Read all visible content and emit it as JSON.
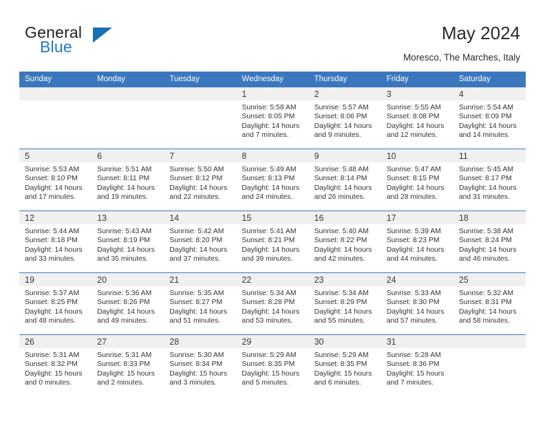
{
  "brand": {
    "name_part1": "General",
    "name_part2": "Blue",
    "triangle_color": "#1a6fb5",
    "blue_text_color": "#1f7ac4"
  },
  "header": {
    "title": "May 2024",
    "subtitle": "Moresco, The Marches, Italy"
  },
  "theme": {
    "header_blue": "#3b77bd",
    "daynum_band": "#f0f0f0",
    "text": "#333333"
  },
  "calendar": {
    "weekday_headers": [
      "Sunday",
      "Monday",
      "Tuesday",
      "Wednesday",
      "Thursday",
      "Friday",
      "Saturday"
    ],
    "weeks": [
      [
        {
          "day": "",
          "empty": true
        },
        {
          "day": "",
          "empty": true
        },
        {
          "day": "",
          "empty": true
        },
        {
          "day": "1",
          "sunrise": "Sunrise: 5:58 AM",
          "sunset": "Sunset: 8:05 PM",
          "daylight1": "Daylight: 14 hours",
          "daylight2": "and 7 minutes."
        },
        {
          "day": "2",
          "sunrise": "Sunrise: 5:57 AM",
          "sunset": "Sunset: 8:06 PM",
          "daylight1": "Daylight: 14 hours",
          "daylight2": "and 9 minutes."
        },
        {
          "day": "3",
          "sunrise": "Sunrise: 5:55 AM",
          "sunset": "Sunset: 8:08 PM",
          "daylight1": "Daylight: 14 hours",
          "daylight2": "and 12 minutes."
        },
        {
          "day": "4",
          "sunrise": "Sunrise: 5:54 AM",
          "sunset": "Sunset: 8:09 PM",
          "daylight1": "Daylight: 14 hours",
          "daylight2": "and 14 minutes."
        }
      ],
      [
        {
          "day": "5",
          "sunrise": "Sunrise: 5:53 AM",
          "sunset": "Sunset: 8:10 PM",
          "daylight1": "Daylight: 14 hours",
          "daylight2": "and 17 minutes."
        },
        {
          "day": "6",
          "sunrise": "Sunrise: 5:51 AM",
          "sunset": "Sunset: 8:11 PM",
          "daylight1": "Daylight: 14 hours",
          "daylight2": "and 19 minutes."
        },
        {
          "day": "7",
          "sunrise": "Sunrise: 5:50 AM",
          "sunset": "Sunset: 8:12 PM",
          "daylight1": "Daylight: 14 hours",
          "daylight2": "and 22 minutes."
        },
        {
          "day": "8",
          "sunrise": "Sunrise: 5:49 AM",
          "sunset": "Sunset: 8:13 PM",
          "daylight1": "Daylight: 14 hours",
          "daylight2": "and 24 minutes."
        },
        {
          "day": "9",
          "sunrise": "Sunrise: 5:48 AM",
          "sunset": "Sunset: 8:14 PM",
          "daylight1": "Daylight: 14 hours",
          "daylight2": "and 26 minutes."
        },
        {
          "day": "10",
          "sunrise": "Sunrise: 5:47 AM",
          "sunset": "Sunset: 8:15 PM",
          "daylight1": "Daylight: 14 hours",
          "daylight2": "and 28 minutes."
        },
        {
          "day": "11",
          "sunrise": "Sunrise: 5:45 AM",
          "sunset": "Sunset: 8:17 PM",
          "daylight1": "Daylight: 14 hours",
          "daylight2": "and 31 minutes."
        }
      ],
      [
        {
          "day": "12",
          "sunrise": "Sunrise: 5:44 AM",
          "sunset": "Sunset: 8:18 PM",
          "daylight1": "Daylight: 14 hours",
          "daylight2": "and 33 minutes."
        },
        {
          "day": "13",
          "sunrise": "Sunrise: 5:43 AM",
          "sunset": "Sunset: 8:19 PM",
          "daylight1": "Daylight: 14 hours",
          "daylight2": "and 35 minutes."
        },
        {
          "day": "14",
          "sunrise": "Sunrise: 5:42 AM",
          "sunset": "Sunset: 8:20 PM",
          "daylight1": "Daylight: 14 hours",
          "daylight2": "and 37 minutes."
        },
        {
          "day": "15",
          "sunrise": "Sunrise: 5:41 AM",
          "sunset": "Sunset: 8:21 PM",
          "daylight1": "Daylight: 14 hours",
          "daylight2": "and 39 minutes."
        },
        {
          "day": "16",
          "sunrise": "Sunrise: 5:40 AM",
          "sunset": "Sunset: 8:22 PM",
          "daylight1": "Daylight: 14 hours",
          "daylight2": "and 42 minutes."
        },
        {
          "day": "17",
          "sunrise": "Sunrise: 5:39 AM",
          "sunset": "Sunset: 8:23 PM",
          "daylight1": "Daylight: 14 hours",
          "daylight2": "and 44 minutes."
        },
        {
          "day": "18",
          "sunrise": "Sunrise: 5:38 AM",
          "sunset": "Sunset: 8:24 PM",
          "daylight1": "Daylight: 14 hours",
          "daylight2": "and 46 minutes."
        }
      ],
      [
        {
          "day": "19",
          "sunrise": "Sunrise: 5:37 AM",
          "sunset": "Sunset: 8:25 PM",
          "daylight1": "Daylight: 14 hours",
          "daylight2": "and 48 minutes."
        },
        {
          "day": "20",
          "sunrise": "Sunrise: 5:36 AM",
          "sunset": "Sunset: 8:26 PM",
          "daylight1": "Daylight: 14 hours",
          "daylight2": "and 49 minutes."
        },
        {
          "day": "21",
          "sunrise": "Sunrise: 5:35 AM",
          "sunset": "Sunset: 8:27 PM",
          "daylight1": "Daylight: 14 hours",
          "daylight2": "and 51 minutes."
        },
        {
          "day": "22",
          "sunrise": "Sunrise: 5:34 AM",
          "sunset": "Sunset: 8:28 PM",
          "daylight1": "Daylight: 14 hours",
          "daylight2": "and 53 minutes."
        },
        {
          "day": "23",
          "sunrise": "Sunrise: 5:34 AM",
          "sunset": "Sunset: 8:29 PM",
          "daylight1": "Daylight: 14 hours",
          "daylight2": "and 55 minutes."
        },
        {
          "day": "24",
          "sunrise": "Sunrise: 5:33 AM",
          "sunset": "Sunset: 8:30 PM",
          "daylight1": "Daylight: 14 hours",
          "daylight2": "and 57 minutes."
        },
        {
          "day": "25",
          "sunrise": "Sunrise: 5:32 AM",
          "sunset": "Sunset: 8:31 PM",
          "daylight1": "Daylight: 14 hours",
          "daylight2": "and 58 minutes."
        }
      ],
      [
        {
          "day": "26",
          "sunrise": "Sunrise: 5:31 AM",
          "sunset": "Sunset: 8:32 PM",
          "daylight1": "Daylight: 15 hours",
          "daylight2": "and 0 minutes."
        },
        {
          "day": "27",
          "sunrise": "Sunrise: 5:31 AM",
          "sunset": "Sunset: 8:33 PM",
          "daylight1": "Daylight: 15 hours",
          "daylight2": "and 2 minutes."
        },
        {
          "day": "28",
          "sunrise": "Sunrise: 5:30 AM",
          "sunset": "Sunset: 8:34 PM",
          "daylight1": "Daylight: 15 hours",
          "daylight2": "and 3 minutes."
        },
        {
          "day": "29",
          "sunrise": "Sunrise: 5:29 AM",
          "sunset": "Sunset: 8:35 PM",
          "daylight1": "Daylight: 15 hours",
          "daylight2": "and 5 minutes."
        },
        {
          "day": "30",
          "sunrise": "Sunrise: 5:29 AM",
          "sunset": "Sunset: 8:35 PM",
          "daylight1": "Daylight: 15 hours",
          "daylight2": "and 6 minutes."
        },
        {
          "day": "31",
          "sunrise": "Sunrise: 5:28 AM",
          "sunset": "Sunset: 8:36 PM",
          "daylight1": "Daylight: 15 hours",
          "daylight2": "and 7 minutes."
        },
        {
          "day": "",
          "empty": true
        }
      ]
    ]
  }
}
